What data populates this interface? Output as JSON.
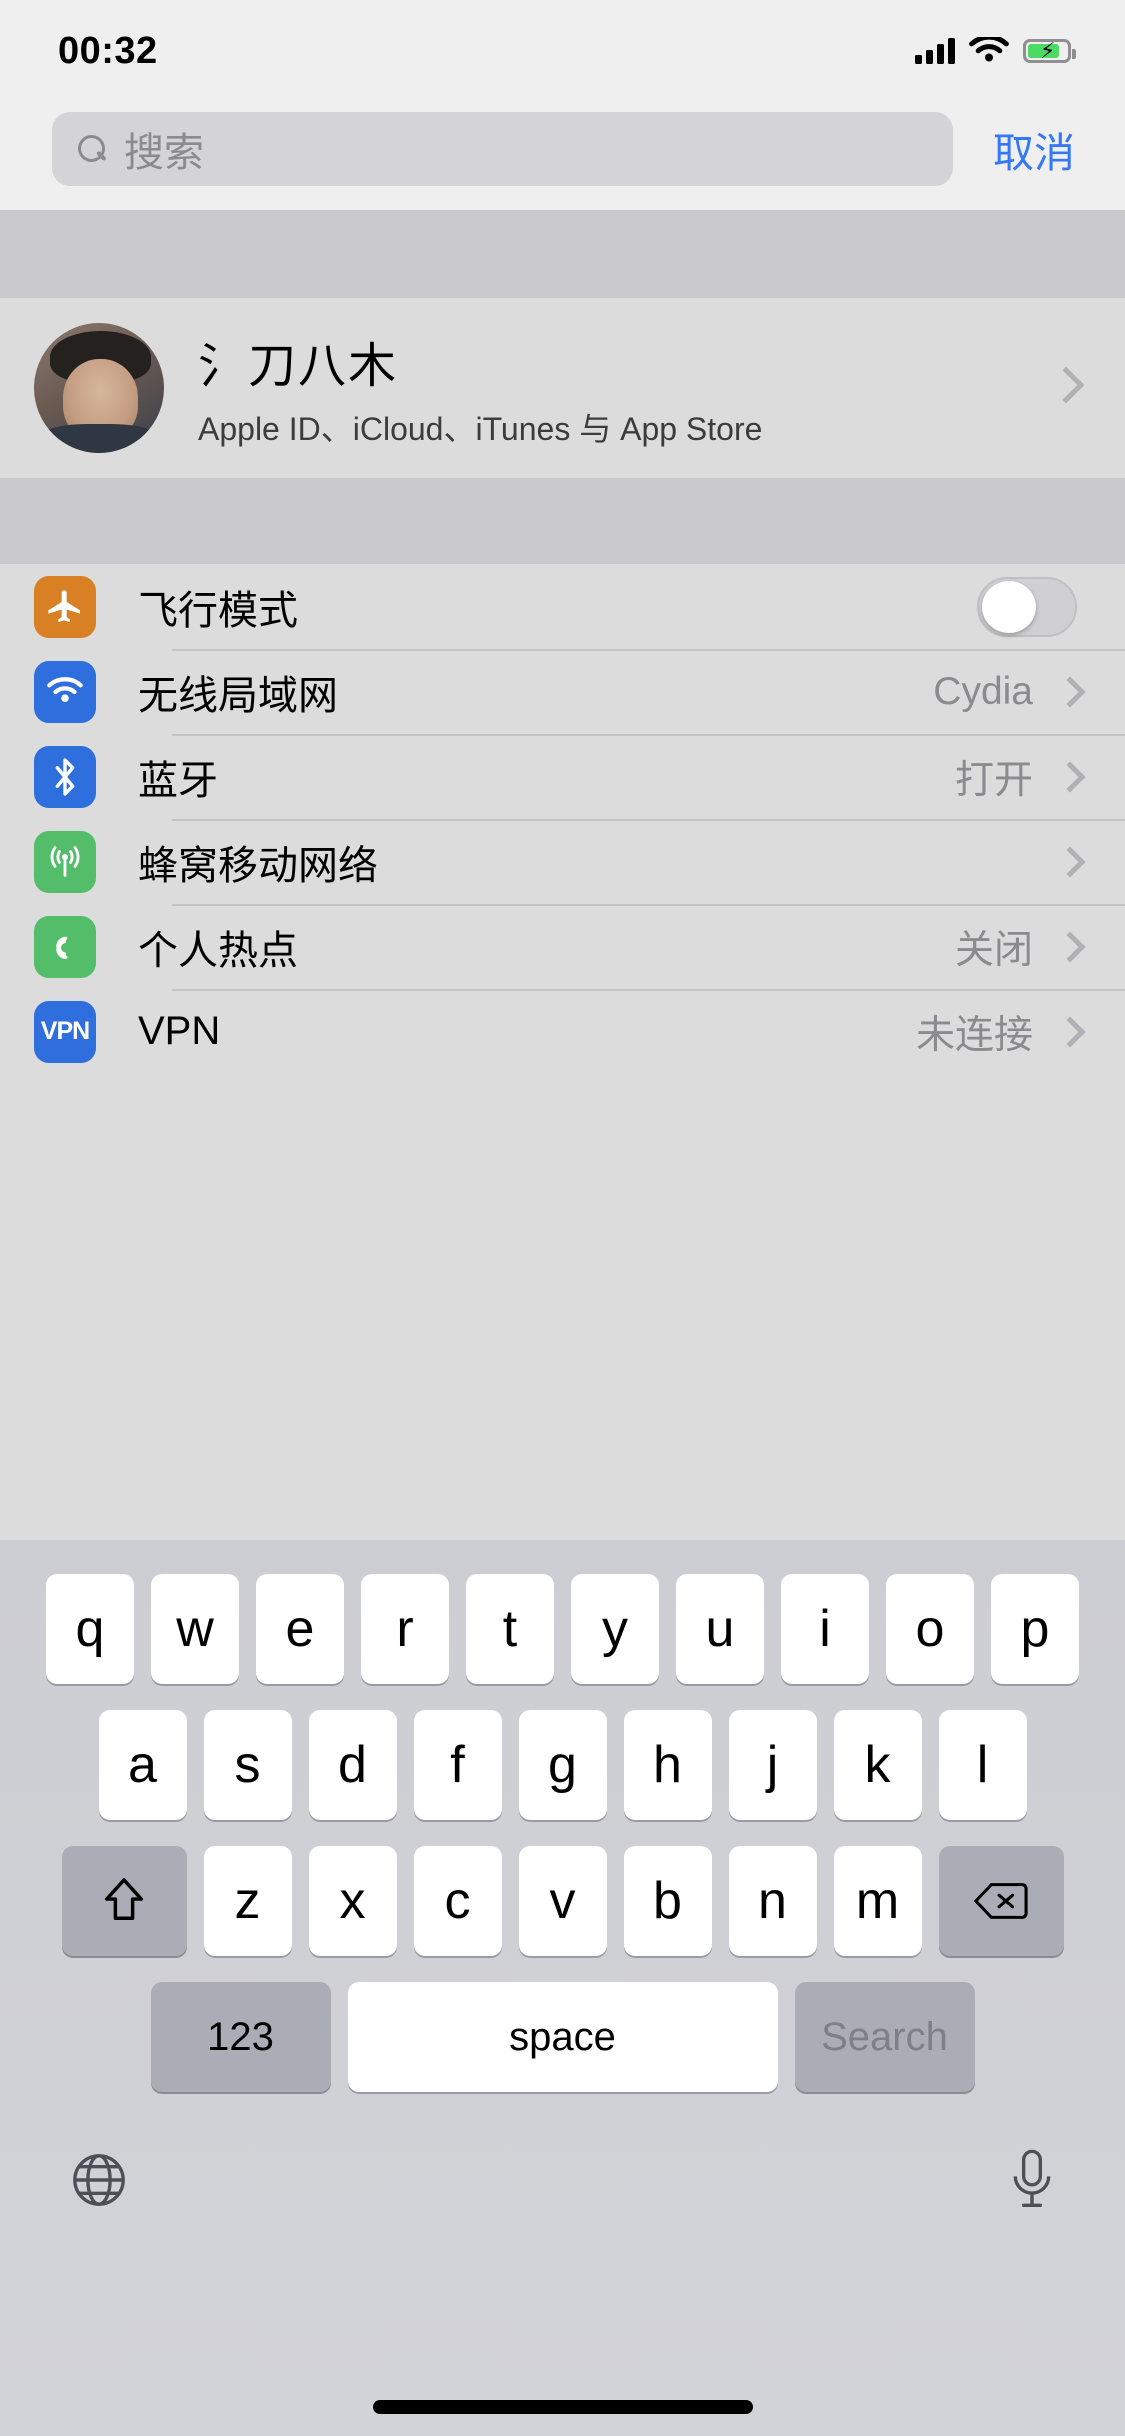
{
  "status_bar": {
    "time": "00:32",
    "signal_icon": "cellular-bars-icon",
    "wifi_icon": "wifi-icon",
    "battery_icon": "battery-charging-icon",
    "battery_color": "#4cd964"
  },
  "search": {
    "placeholder": "搜索",
    "value": "",
    "cancel_label": "取消",
    "icon": "search-icon"
  },
  "profile": {
    "name": "氵刀八木",
    "subtitle": "Apple ID、iCloud、iTunes 与 App Store",
    "avatar": "user-photo-avatar",
    "chevron": "chevron-right-icon"
  },
  "settings_rows": [
    {
      "label": "飞行模式",
      "value": "",
      "icon": "airplane-icon",
      "icon_color": "#d98024",
      "control": "toggle",
      "toggle_on": false
    },
    {
      "label": "无线局域网",
      "value": "Cydia",
      "icon": "wifi-icon",
      "icon_color": "#2f6fdd",
      "control": "chevron"
    },
    {
      "label": "蓝牙",
      "value": "打开",
      "icon": "bluetooth-icon",
      "icon_color": "#2f6fdd",
      "control": "chevron"
    },
    {
      "label": "蜂窝移动网络",
      "value": "",
      "icon": "cellular-icon",
      "icon_color": "#54bd6a",
      "control": "chevron"
    },
    {
      "label": "个人热点",
      "value": "关闭",
      "icon": "hotspot-icon",
      "icon_color": "#54bd6a",
      "control": "chevron"
    },
    {
      "label": "VPN",
      "value": "未连接",
      "icon": "vpn-icon",
      "icon_color": "#2f6fdd",
      "control": "chevron",
      "icon_text": "VPN"
    }
  ],
  "keyboard": {
    "row1": [
      "q",
      "w",
      "e",
      "r",
      "t",
      "y",
      "u",
      "i",
      "o",
      "p"
    ],
    "row2": [
      "a",
      "s",
      "d",
      "f",
      "g",
      "h",
      "j",
      "k",
      "l"
    ],
    "row3": [
      "z",
      "x",
      "c",
      "v",
      "b",
      "n",
      "m"
    ],
    "shift_key": "shift-icon",
    "delete_key": "delete-backspace-icon",
    "numbers_label": "123",
    "space_label": "space",
    "return_label": "Search",
    "globe_icon": "globe-icon",
    "mic_icon": "microphone-icon"
  },
  "colors": {
    "accent_blue": "#3478f6",
    "page_background": "#efeff0",
    "dim_overlay": "#dcdcdc",
    "separator": "#c9c9ce"
  }
}
